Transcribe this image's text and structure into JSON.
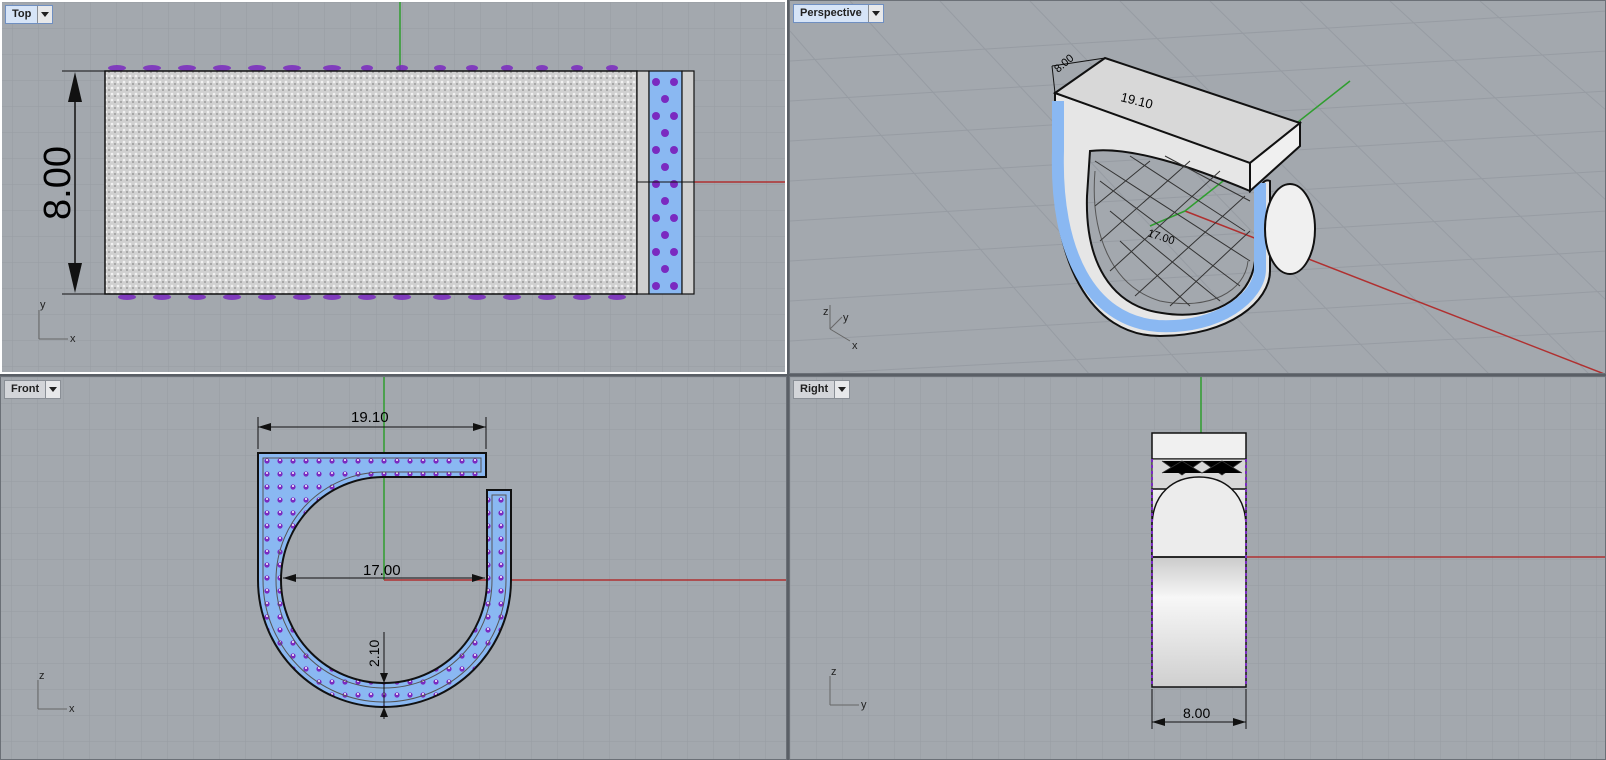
{
  "viewports": {
    "top": {
      "title": "Top",
      "dimension": "8.00",
      "axis": {
        "horizontal": "x",
        "vertical": "y"
      }
    },
    "perspective": {
      "title": "Perspective",
      "dimensions": [
        "19.10",
        "8.00",
        "17.00"
      ],
      "axis": {
        "x": "x",
        "y": "y",
        "z": "z"
      }
    },
    "front": {
      "title": "Front",
      "dimensions": {
        "width": "19.10",
        "inner": "17.00",
        "thickness": "2.10"
      },
      "axis": {
        "horizontal": "x",
        "vertical": "z"
      }
    },
    "right": {
      "title": "Right",
      "dimension": "8.00",
      "axis": {
        "horizontal": "y",
        "vertical": "z"
      }
    }
  },
  "colors": {
    "grid_bg": "#a3a8ae",
    "grid_minor": "#979ca3",
    "grid_major": "#8d9299",
    "x_axis": "#b03030",
    "y_axis": "#2f9e2f",
    "gem_fill": "#8ab8f2",
    "gem_stone": "#7a2ac0",
    "metal": "#e6e6e6"
  }
}
